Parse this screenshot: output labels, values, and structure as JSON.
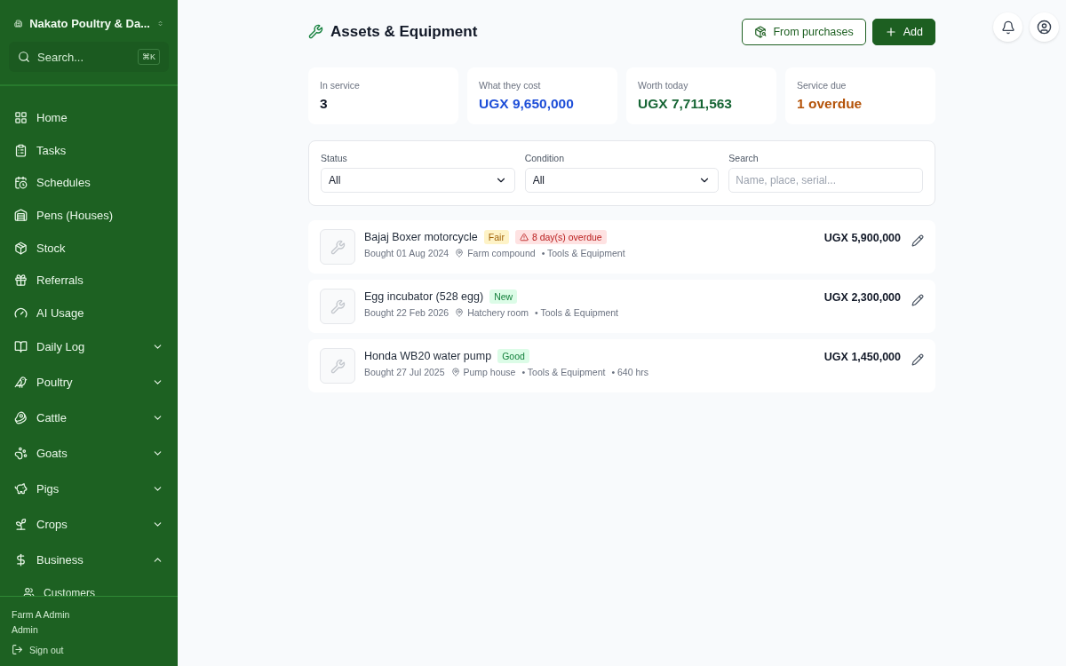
{
  "sidebar": {
    "farm_name": "Nakato Poultry & Da...",
    "search": {
      "placeholder": "Search...",
      "shortcut": "⌘K"
    },
    "items": [
      {
        "label": "Home"
      },
      {
        "label": "Tasks"
      },
      {
        "label": "Schedules"
      },
      {
        "label": "Pens (Houses)"
      },
      {
        "label": "Stock"
      },
      {
        "label": "Referrals"
      },
      {
        "label": "AI Usage"
      },
      {
        "label": "Daily Log",
        "expanded": false
      },
      {
        "label": "Poultry",
        "expanded": false
      },
      {
        "label": "Cattle",
        "expanded": false
      },
      {
        "label": "Goats",
        "expanded": false
      },
      {
        "label": "Pigs",
        "expanded": false
      },
      {
        "label": "Crops",
        "expanded": false
      },
      {
        "label": "Business",
        "expanded": true,
        "children": [
          {
            "label": "Customers"
          }
        ]
      }
    ],
    "user": {
      "name": "Farm A Admin",
      "role": "Admin",
      "sign_out": "Sign out"
    }
  },
  "page": {
    "title": "Assets & Equipment",
    "buttons": [
      {
        "label": "From purchases",
        "kind": "outline"
      },
      {
        "label": "Add",
        "kind": "primary"
      }
    ]
  },
  "stats": [
    {
      "label": "In service",
      "value": "3",
      "color": "#111827"
    },
    {
      "label": "What they cost",
      "value": "UGX 9,650,000",
      "color": "#1d4ed8"
    },
    {
      "label": "Worth today",
      "value": "UGX 7,711,563",
      "color": "#166534"
    },
    {
      "label": "Service due",
      "value": "1 overdue",
      "color": "#b45309"
    }
  ],
  "filters": {
    "status": {
      "label": "Status",
      "value": "All"
    },
    "condition": {
      "label": "Condition",
      "value": "All"
    },
    "search": {
      "label": "Search",
      "placeholder": "Name, place, serial..."
    }
  },
  "assets": [
    {
      "name": "Bajaj Boxer motorcycle",
      "badges": [
        {
          "text": "Fair",
          "kind": "warning"
        },
        {
          "text": "8 day(s) overdue",
          "kind": "danger"
        }
      ],
      "meta": [
        {
          "text": "Bought 01 Aug 2024",
          "kind": "date"
        },
        {
          "text": "Farm compound",
          "kind": "location"
        },
        {
          "text": "• Tools & Equipment",
          "kind": "tag"
        }
      ],
      "price": "UGX 5,900,000"
    },
    {
      "name": "Egg incubator (528 egg)",
      "badges": [
        {
          "text": "New",
          "kind": "success"
        }
      ],
      "meta": [
        {
          "text": "Bought 22 Feb 2026",
          "kind": "date"
        },
        {
          "text": "Hatchery room",
          "kind": "location"
        },
        {
          "text": "• Tools & Equipment",
          "kind": "tag"
        }
      ],
      "price": "UGX 2,300,000"
    },
    {
      "name": "Honda WB20 water pump",
      "badges": [
        {
          "text": "Good",
          "kind": "success"
        }
      ],
      "meta": [
        {
          "text": "Bought 27 Jul 2025",
          "kind": "date"
        },
        {
          "text": "Pump house",
          "kind": "location"
        },
        {
          "text": "• Tools & Equipment",
          "kind": "tag"
        },
        {
          "text": "• 640 hrs",
          "kind": "tag"
        }
      ],
      "price": "UGX 1,450,000"
    }
  ]
}
